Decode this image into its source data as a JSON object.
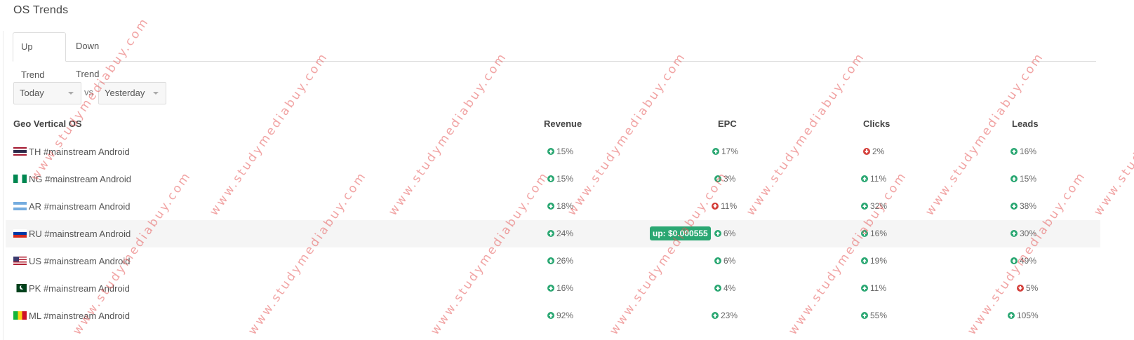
{
  "page": {
    "title": "OS Trends"
  },
  "tabs": [
    {
      "label": "Up Trend",
      "active": true
    },
    {
      "label": "Down Trend",
      "active": false
    }
  ],
  "filters": {
    "current": "Today",
    "vs": "vs",
    "compare": "Yesterday"
  },
  "table": {
    "columns": [
      "Geo Vertical OS",
      "Revenue",
      "EPC",
      "Clicks",
      "Leads"
    ],
    "rows": [
      {
        "flag": "TH",
        "label": "TH #mainstream Android",
        "revenue": {
          "dir": "up",
          "value": "15%"
        },
        "epc": {
          "dir": "up",
          "value": "17%"
        },
        "clicks": {
          "dir": "down",
          "value": "2%"
        },
        "leads": {
          "dir": "up",
          "value": "16%"
        }
      },
      {
        "flag": "NG",
        "label": "NG #mainstream Android",
        "revenue": {
          "dir": "up",
          "value": "15%"
        },
        "epc": {
          "dir": "up",
          "value": "3%"
        },
        "clicks": {
          "dir": "up",
          "value": "11%"
        },
        "leads": {
          "dir": "up",
          "value": "15%"
        }
      },
      {
        "flag": "AR",
        "label": "AR #mainstream Android",
        "revenue": {
          "dir": "up",
          "value": "18%"
        },
        "epc": {
          "dir": "down",
          "value": "11%"
        },
        "clicks": {
          "dir": "up",
          "value": "32%"
        },
        "leads": {
          "dir": "up",
          "value": "38%"
        }
      },
      {
        "flag": "RU",
        "label": "RU #mainstream Android",
        "revenue": {
          "dir": "up",
          "value": "24%"
        },
        "epc": {
          "dir": "up",
          "value": "6%"
        },
        "clicks": {
          "dir": "up",
          "value": "16%"
        },
        "leads": {
          "dir": "up",
          "value": "30%"
        }
      },
      {
        "flag": "US",
        "label": "US #mainstream Android",
        "revenue": {
          "dir": "up",
          "value": "26%"
        },
        "epc": {
          "dir": "up",
          "value": "6%"
        },
        "clicks": {
          "dir": "up",
          "value": "19%"
        },
        "leads": {
          "dir": "up",
          "value": "49%"
        }
      },
      {
        "flag": "PK",
        "label": "PK #mainstream Android",
        "revenue": {
          "dir": "up",
          "value": "16%"
        },
        "epc": {
          "dir": "up",
          "value": "4%"
        },
        "clicks": {
          "dir": "up",
          "value": "11%"
        },
        "leads": {
          "dir": "down",
          "value": "5%"
        }
      },
      {
        "flag": "ML",
        "label": "ML #mainstream Android",
        "revenue": {
          "dir": "up",
          "value": "92%"
        },
        "epc": {
          "dir": "up",
          "value": "23%"
        },
        "clicks": {
          "dir": "up",
          "value": "55%"
        },
        "leads": {
          "dir": "up",
          "value": "105%"
        }
      }
    ]
  },
  "tooltip": {
    "text": "up: $0.000555"
  },
  "watermark": {
    "text": "www.studymediabuy.com"
  },
  "colors": {
    "up": "#2aa772",
    "down": "#d43f3a",
    "watermark": "#e65a5a"
  }
}
